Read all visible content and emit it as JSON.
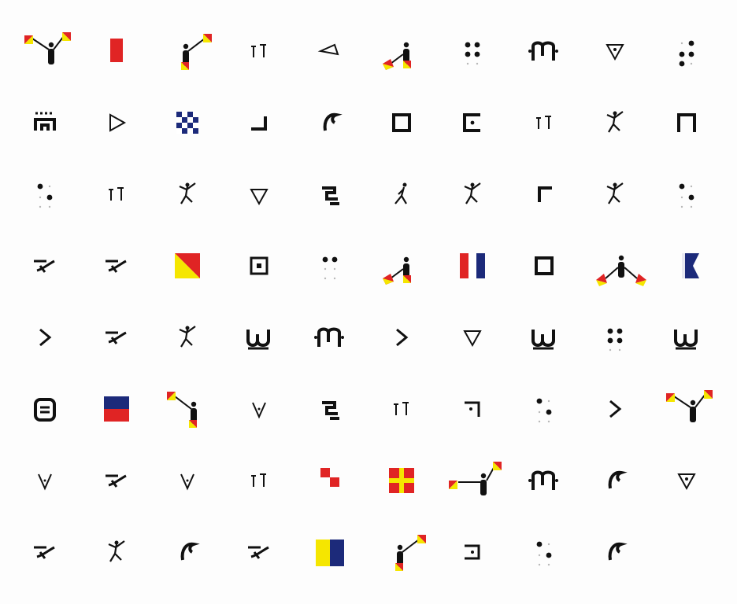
{
  "sheet": {
    "colors": {
      "ink": "#111111",
      "flag_red": "#e02424",
      "flag_yellow": "#f5e600",
      "flag_navy": "#1c2a7a",
      "braille_faint": "#b8b8b8"
    },
    "rows": [
      [
        "semaphore-flags-up-v",
        "red-signal-flag",
        "semaphore-flags-high-right",
        "tick-glyph",
        "diamond-left-outline",
        "semaphore-flags-low-left",
        "braille-four-dots",
        "ornate-glyph-m",
        "triangle-down-dot",
        "braille-three-right"
      ],
      [
        "dotted-arch-glyph",
        "triangle-right-outline",
        "checkered-blue-flag",
        "corner-bottom-right-glyph",
        "hook-glyph",
        "square-outline",
        "e-shape-glyph",
        "tick-glyph",
        "dancing-figure-glyph",
        "pi-shape-glyph"
      ],
      [
        "braille-dot-pattern",
        "tick-glyph",
        "dancing-figure-glyph",
        "diamond-down-outline",
        "spiral-glyph",
        "running-figure-glyph",
        "dancing-figure-glyph",
        "corner-top-left-glyph",
        "dancing-figure-glyph",
        "braille-dot-pattern"
      ],
      [
        "script-glyph",
        "script-glyph",
        "yellow-red-diagonal-flag",
        "square-with-dot-glyph",
        "braille-two-top",
        "semaphore-flags-low-left",
        "tricolor-blue-white-red-flag",
        "square-outline",
        "semaphore-flags-low-both",
        "swallowtail-navy-flag"
      ],
      [
        "chevron-right-glyph",
        "script-glyph",
        "dancing-figure-glyph",
        "ornate-glyph-w",
        "ornate-glyph-m",
        "chevron-right-glyph",
        "triangle-down-outline",
        "ornate-glyph-w",
        "braille-four-dots",
        "ornate-glyph-w"
      ],
      [
        "boxed-glyph",
        "blue-red-horizontal-flag",
        "semaphore-flags-high-left",
        "v-glyph",
        "spiral-glyph",
        "tick-glyph",
        "corner-top-right-glyph",
        "braille-dot-pattern",
        "chevron-right-glyph",
        "semaphore-flags-up-v"
      ],
      [
        "v-glyph",
        "script-glyph",
        "v-glyph",
        "tick-glyph",
        "red-white-checkered-flag",
        "red-yellow-cross-flag",
        "semaphore-flags-horizontal",
        "ornate-glyph-m",
        "hook-glyph",
        "triangle-down-dot"
      ],
      [
        "script-glyph",
        "dancing-figure-glyph",
        "hook-glyph",
        "script-glyph",
        "yellow-blue-vertical-flag",
        "semaphore-flags-high-right",
        "corner-glyph",
        "braille-dot-pattern",
        "hook-glyph",
        null
      ]
    ]
  }
}
